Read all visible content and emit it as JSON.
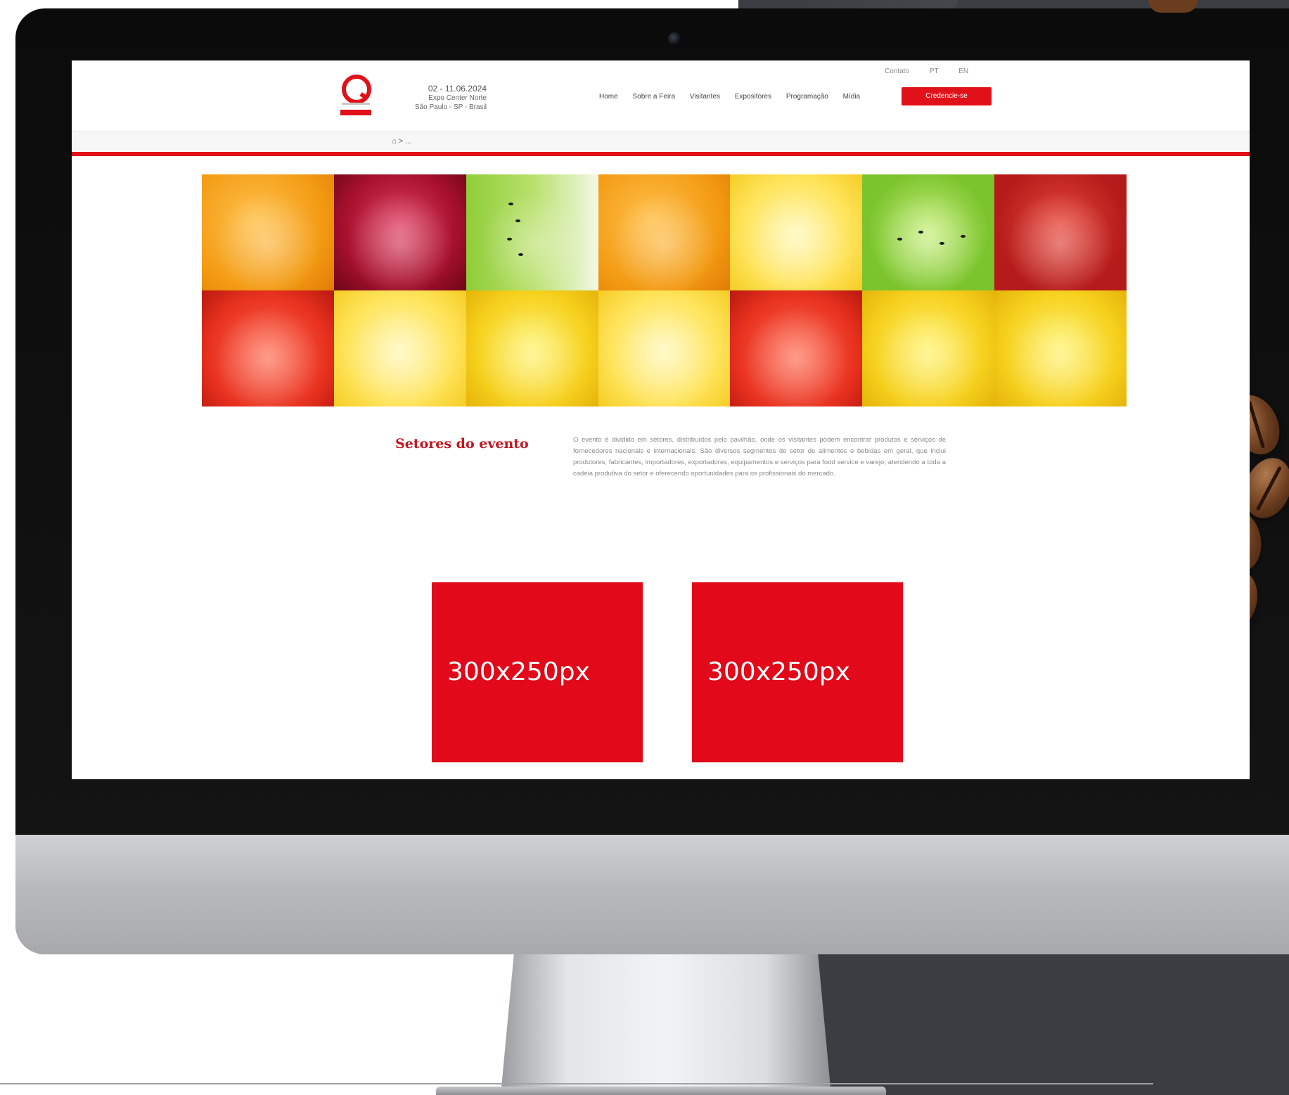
{
  "header": {
    "event_date": "02 - 11.06.2024",
    "event_venue_line1": "Expo Center Norte",
    "event_venue_line2": "São Paulo - SP - Brasil",
    "top_links": [
      "Contato",
      "PT",
      "EN"
    ],
    "nav_items": [
      "Home",
      "Sobre a Feira",
      "Visitantes",
      "Expositores",
      "Programação",
      "Mídia"
    ],
    "cta_label": "Credencie-se"
  },
  "breadcrumb": {
    "home_icon": "home-icon",
    "separator": ">",
    "current": "..."
  },
  "content": {
    "section_title": "Setores do evento",
    "section_text": "O evento é dividido em setores, distribuídos pelo pavilhão, onde os visitantes podem encontrar produtos e serviços de fornecedores nacionais e internacionais. São diversos segmentos do setor de alimentos e bebidas em geral, que inclui produtores, fabricantes, importadores, exportadores, equipamentos e serviços para food service e varejo, atendendo a toda a cadeia produtiva do setor e oferecendo oportunidades para os profissionais do mercado."
  },
  "ads": [
    {
      "label": "300x250px"
    },
    {
      "label": "300x250px"
    }
  ],
  "colors": {
    "brand_red": "#e1111a",
    "ad_red": "#e1091a",
    "title_red": "#c5141e"
  }
}
